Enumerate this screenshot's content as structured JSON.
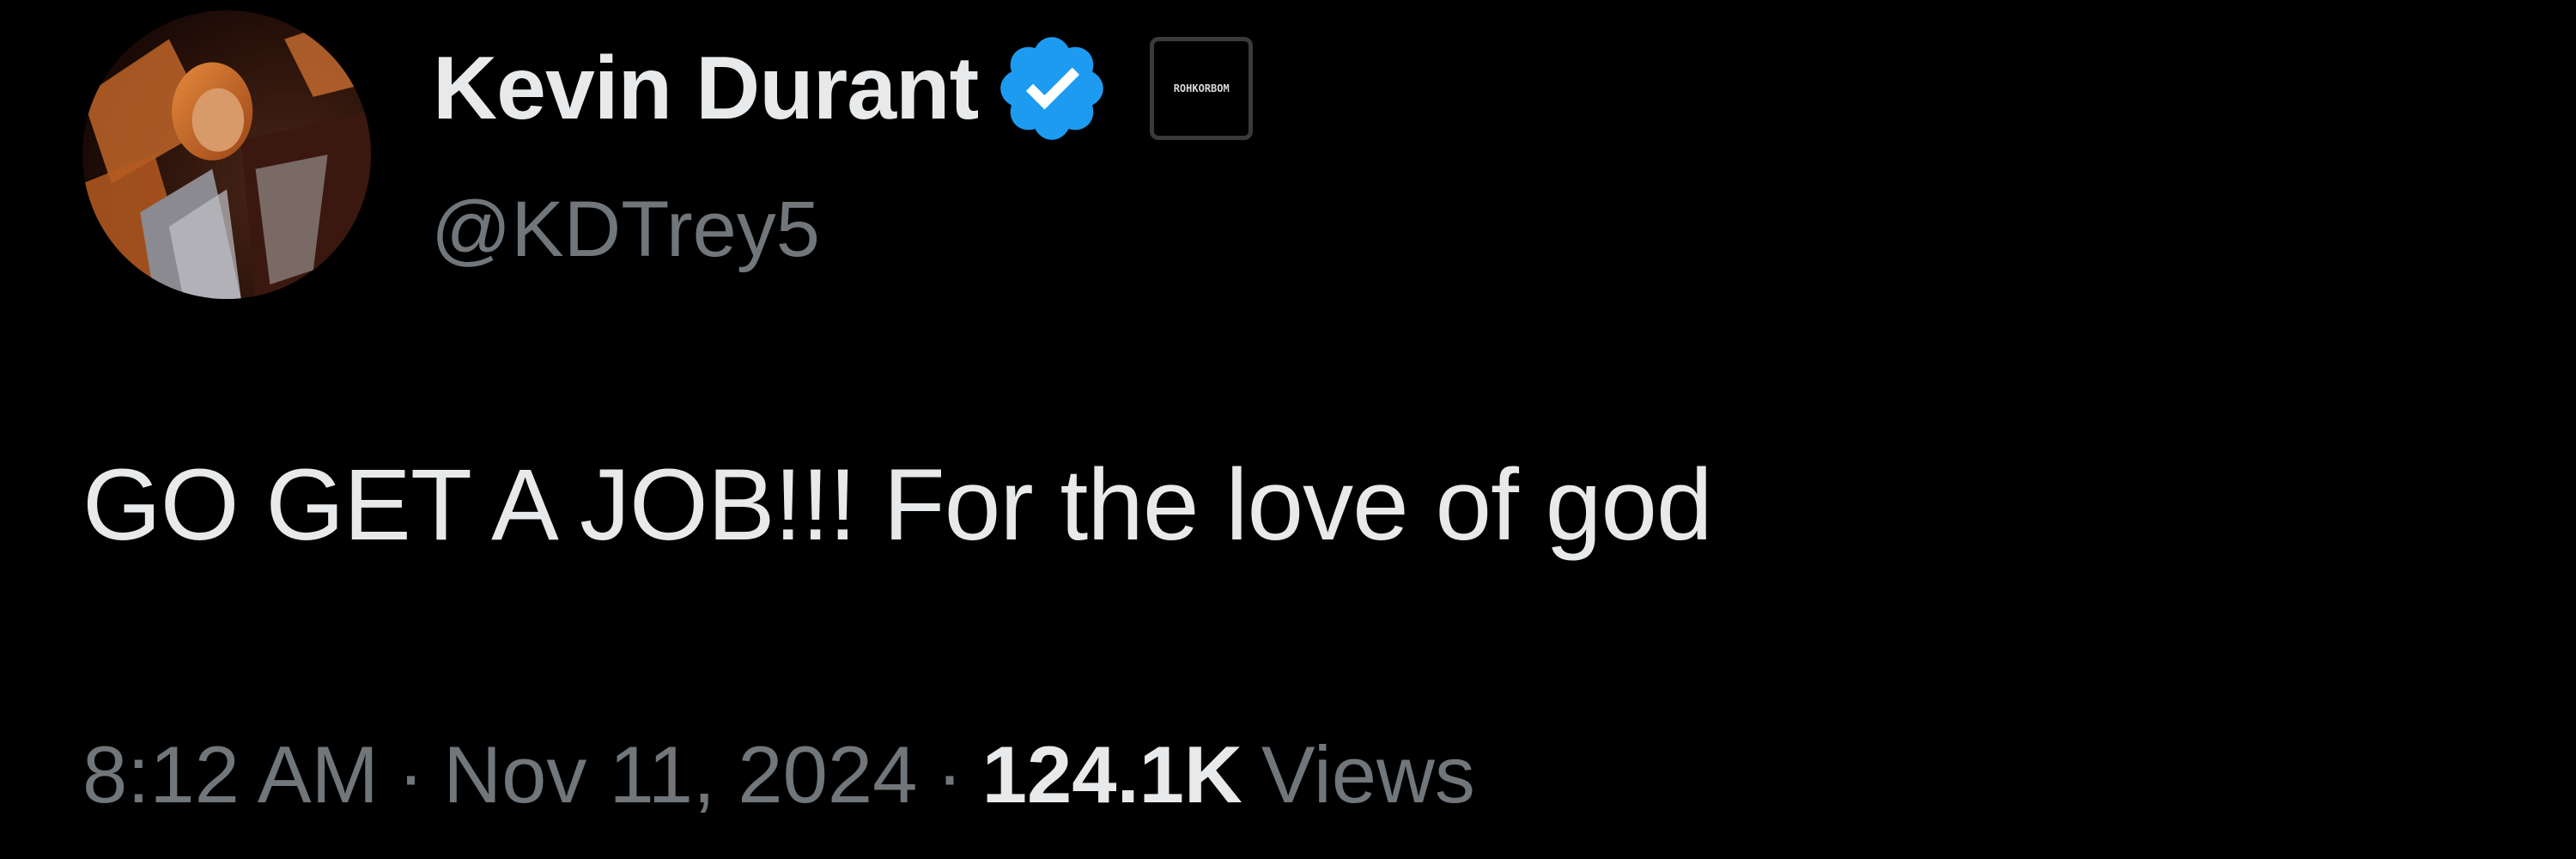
{
  "tweet": {
    "author": {
      "display_name": "Kevin Durant",
      "handle": "@KDTrey5",
      "verified": true,
      "verified_color": "#1d9bf0",
      "affiliate_badge_text": "ROHKORBOM"
    },
    "text": "GO GET A JOB!!! For the love of god",
    "meta": {
      "time": "8:12 AM",
      "separator": "·",
      "date": "Nov 11, 2024",
      "views_count": "124.1K",
      "views_label": "Views"
    }
  },
  "colors": {
    "background": "#000000",
    "primary_text": "#e7e9ea",
    "secondary_text": "#71767b"
  }
}
